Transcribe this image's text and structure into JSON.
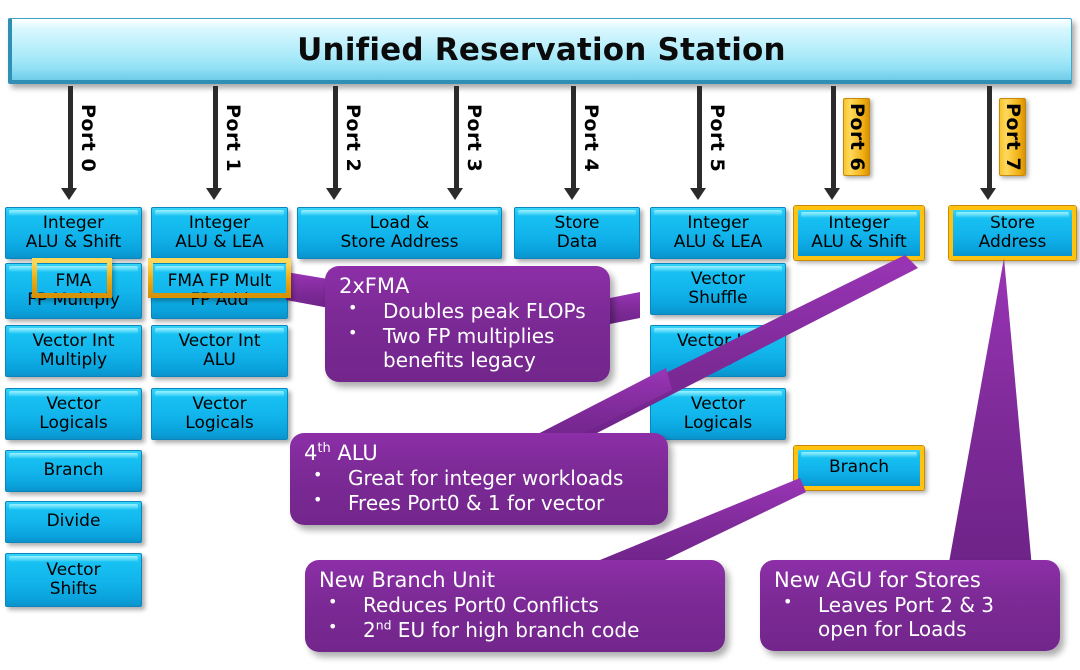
{
  "header": {
    "title": "Unified Reservation Station"
  },
  "colors": {
    "box_blue": "#13b9ef",
    "highlight_gold": "#ffc20e",
    "callout_purple": "#7d2a97",
    "header_cyan": "#a9eaf9",
    "arrow_black": "#2b2b2b"
  },
  "ports": [
    {
      "label": "Port 0",
      "highlighted": false
    },
    {
      "label": "Port 1",
      "highlighted": false
    },
    {
      "label": "Port 2",
      "highlighted": false
    },
    {
      "label": "Port 3",
      "highlighted": false
    },
    {
      "label": "Port 4",
      "highlighted": false
    },
    {
      "label": "Port 5",
      "highlighted": false
    },
    {
      "label": "Port 6",
      "highlighted": true
    },
    {
      "label": "Port 7",
      "highlighted": true
    }
  ],
  "columns": [
    {
      "port": "Port 0",
      "units": [
        "Integer\nALU & Shift",
        "FMA\nFP Multiply",
        "Vector Int\nMultiply",
        "Vector\nLogicals",
        "Branch",
        "Divide",
        "Vector\nShifts"
      ]
    },
    {
      "port": "Port 1",
      "units": [
        "Integer\nALU & LEA",
        "FMA FP Mult\nFP Add",
        "Vector Int\nALU",
        "Vector\nLogicals"
      ]
    },
    {
      "port": "Port 2 / Port 3",
      "units": [
        "Load &\nStore Address"
      ]
    },
    {
      "port": "Port 4",
      "units": [
        "Store\nData"
      ]
    },
    {
      "port": "Port 5",
      "units": [
        "Integer\nALU & LEA",
        "Vector\nShuffle",
        "Vector Int\nALU",
        "Vector\nLogicals"
      ]
    },
    {
      "port": "Port 6",
      "units": [
        "Integer\nALU & Shift",
        "Branch"
      ]
    },
    {
      "port": "Port 7",
      "units": [
        "Store\nAddress"
      ]
    }
  ],
  "highlight_rings": [
    {
      "label": "FMA",
      "on_unit": "FMA / FP Multiply (Port 0)"
    },
    {
      "label": "FMA FP Mult",
      "on_unit": "FMA FP Mult / FP Add (Port 1)"
    }
  ],
  "callouts": [
    {
      "title": "2xFMA",
      "bullets": [
        "Doubles peak FLOPs",
        "Two FP multiplies\nbenefits legacy"
      ]
    },
    {
      "title_pre": "4",
      "title_sup": "th",
      "title_post": " ALU",
      "bullets": [
        "Great for integer workloads",
        "Frees Port0 & 1 for vector"
      ]
    },
    {
      "title": "New Branch Unit",
      "bullets": [
        "Reduces Port0 Conflicts"
      ],
      "bullet2_pre": "2",
      "bullet2_sup": "nd",
      "bullet2_post": " EU for high branch code"
    },
    {
      "title": "New AGU for Stores",
      "bullets": [
        "Leaves Port 2 & 3\nopen for Loads"
      ]
    }
  ]
}
